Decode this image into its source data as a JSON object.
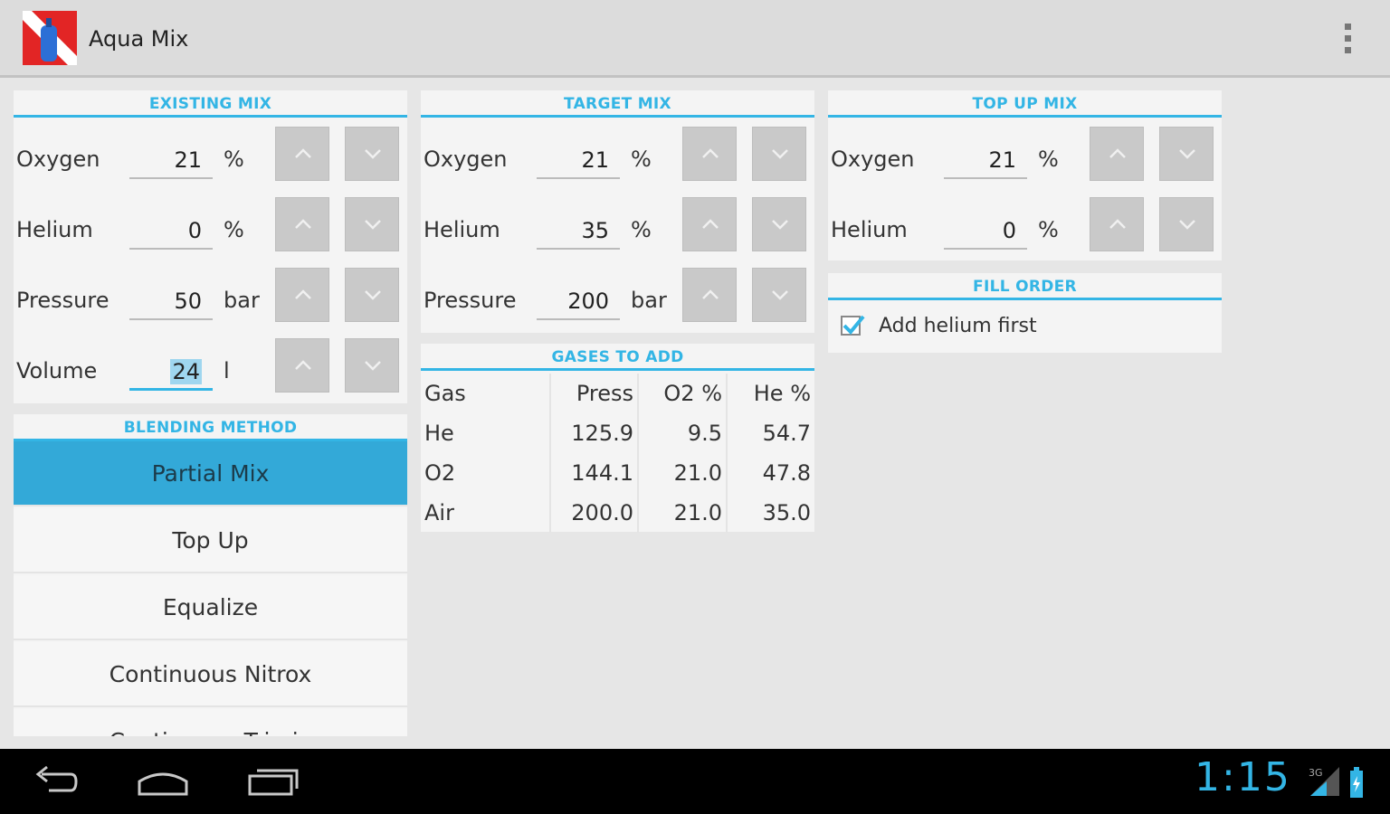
{
  "app": {
    "title": "Aqua Mix",
    "icon": "dive-flag-tank-icon"
  },
  "existing_mix": {
    "header": "EXISTING MIX",
    "rows": [
      {
        "label": "Oxygen",
        "value": "21",
        "unit": "%"
      },
      {
        "label": "Helium",
        "value": "0",
        "unit": "%"
      },
      {
        "label": "Pressure",
        "value": "50",
        "unit": "bar"
      },
      {
        "label": "Volume",
        "value": "24",
        "unit": "l"
      }
    ]
  },
  "target_mix": {
    "header": "TARGET MIX",
    "rows": [
      {
        "label": "Oxygen",
        "value": "21",
        "unit": "%"
      },
      {
        "label": "Helium",
        "value": "35",
        "unit": "%"
      },
      {
        "label": "Pressure",
        "value": "200",
        "unit": "bar"
      }
    ]
  },
  "top_up_mix": {
    "header": "TOP UP MIX",
    "rows": [
      {
        "label": "Oxygen",
        "value": "21",
        "unit": "%"
      },
      {
        "label": "Helium",
        "value": "0",
        "unit": "%"
      }
    ]
  },
  "fill_order": {
    "header": "FILL ORDER",
    "checkbox_label": "Add helium first",
    "checked": true
  },
  "blending_method": {
    "header": "BLENDING METHOD",
    "selected": "Partial Mix",
    "items": [
      "Partial Mix",
      "Top Up",
      "Equalize",
      "Continuous Nitrox",
      "Continuous Trimix"
    ]
  },
  "gases_to_add": {
    "header": "GASES TO ADD",
    "columns": [
      "Gas",
      "Press",
      "O2 %",
      "He %"
    ],
    "rows": [
      [
        "He",
        "125.9",
        "9.5",
        "54.7"
      ],
      [
        "O2",
        "144.1",
        "21.0",
        "47.8"
      ],
      [
        "Air",
        "200.0",
        "21.0",
        "35.0"
      ]
    ]
  },
  "status": {
    "time": "1:15",
    "accent": "#33b5e5"
  }
}
